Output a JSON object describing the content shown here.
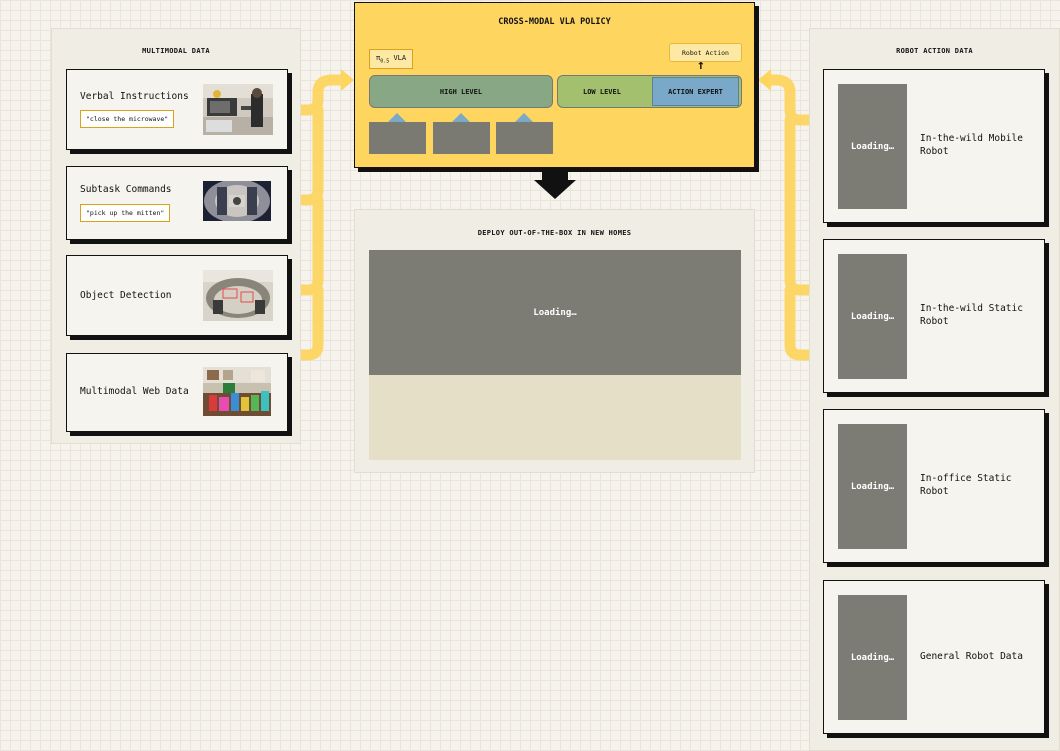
{
  "multimodal": {
    "title": "MULTIMODAL DATA",
    "items": [
      {
        "label": "Verbal Instructions",
        "quote": "\"close the microwave\""
      },
      {
        "label": "Subtask Commands",
        "quote": "\"pick up the mitten\""
      },
      {
        "label": "Object Detection"
      },
      {
        "label": "Multimodal Web Data"
      }
    ]
  },
  "vla": {
    "title": "CROSS-MODAL VLA POLICY",
    "badge_pi": "π",
    "badge_sub": "0.5",
    "badge_text": "VLA",
    "robot_action": "Robot Action",
    "high_level": "HIGH LEVEL",
    "low_level": "LOW LEVEL",
    "action_expert": "ACTION EXPERT",
    "up_arrow": "↑"
  },
  "deploy": {
    "title": "DEPLOY OUT-OF-THE-BOX IN NEW HOMES",
    "loading": "Loading…"
  },
  "robot": {
    "title": "ROBOT ACTION DATA",
    "items": [
      {
        "loading": "Loading…",
        "label": "In-the-wild Mobile Robot"
      },
      {
        "loading": "Loading…",
        "label": "In-the-wild Static Robot"
      },
      {
        "loading": "Loading…",
        "label": "In-office Static Robot"
      },
      {
        "loading": "Loading…",
        "label": "General Robot Data"
      }
    ]
  },
  "colors": {
    "vla_bg": "#fdd55f",
    "high_level": "#88a885",
    "low_level": "#a2c06d",
    "action_expert": "#7aa8c9",
    "flow_arrow": "#fdd55f",
    "loading_bg": "#7c7b74"
  }
}
